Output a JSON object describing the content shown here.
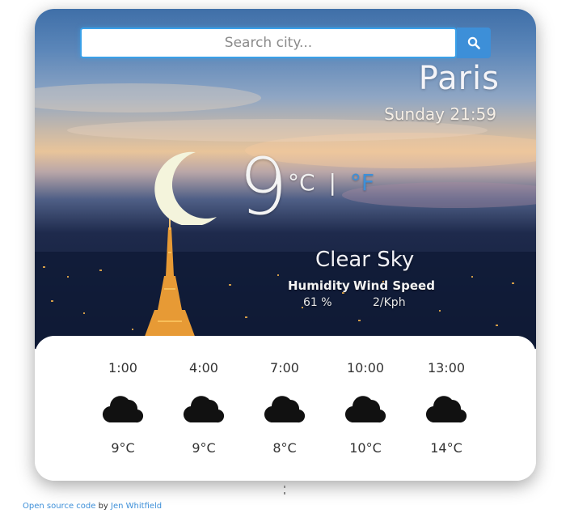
{
  "search": {
    "placeholder": "Search city..."
  },
  "current": {
    "city": "Paris",
    "datetime": "Sunday 21:59",
    "temperature": "9",
    "unit_c": "°C",
    "unit_sep": "|",
    "unit_f": "°F",
    "condition": "Clear Sky",
    "condition_icon": "moon-icon",
    "humidity_label": "Humidity",
    "humidity_value": "61 %",
    "wind_label": "Wind Speed",
    "wind_value": "2/Kph"
  },
  "forecast": [
    {
      "time": "1:00",
      "icon": "cloud-icon",
      "temp": "9°C"
    },
    {
      "time": "4:00",
      "icon": "cloud-icon",
      "temp": "9°C"
    },
    {
      "time": "7:00",
      "icon": "cloud-icon",
      "temp": "8°C"
    },
    {
      "time": "10:00",
      "icon": "cloud-icon",
      "temp": "10°C"
    },
    {
      "time": "13:00",
      "icon": "cloud-icon",
      "temp": "14°C"
    }
  ],
  "footer": {
    "link_text": "Open source code",
    "by": "by",
    "author": "Jen Whitfield"
  },
  "colors": {
    "accent": "#3d8fd8",
    "moon": "#f4f4dc"
  }
}
